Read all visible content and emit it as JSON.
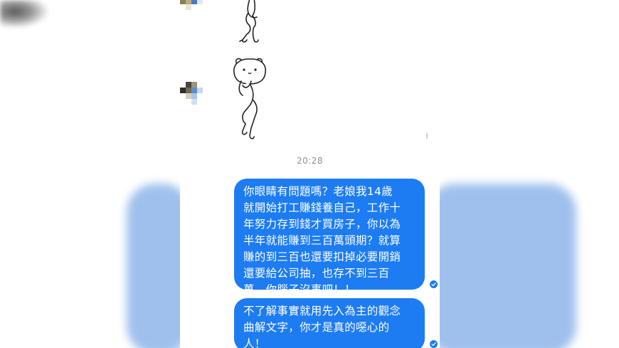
{
  "conversation": {
    "timestamp": "20:28",
    "messages": [
      {
        "lines": [
          "你眼睛有問題嗎？老娘我14歲",
          "就開始打工賺錢養自己，工作十",
          "年努力存到錢才買房子，你以為",
          "半年就能賺到三百萬頭期？就算",
          "賺的到三百也還要扣掉必要開銷",
          "還要給公司抽，也存不到三百",
          "萬，你腦子沒事吧！！"
        ],
        "status_icon": "check-icon"
      },
      {
        "lines": [
          "不了解事實就用先入為主的觀念",
          "曲解文字，你才是真的噁心的",
          "人！"
        ],
        "status_icon": "check-icon"
      }
    ]
  },
  "colors": {
    "bubble": "#1d7cf2",
    "bubble_text": "#ffffff",
    "timestamp": "#8e8e93",
    "blurred_background": "#8fb6ea"
  }
}
